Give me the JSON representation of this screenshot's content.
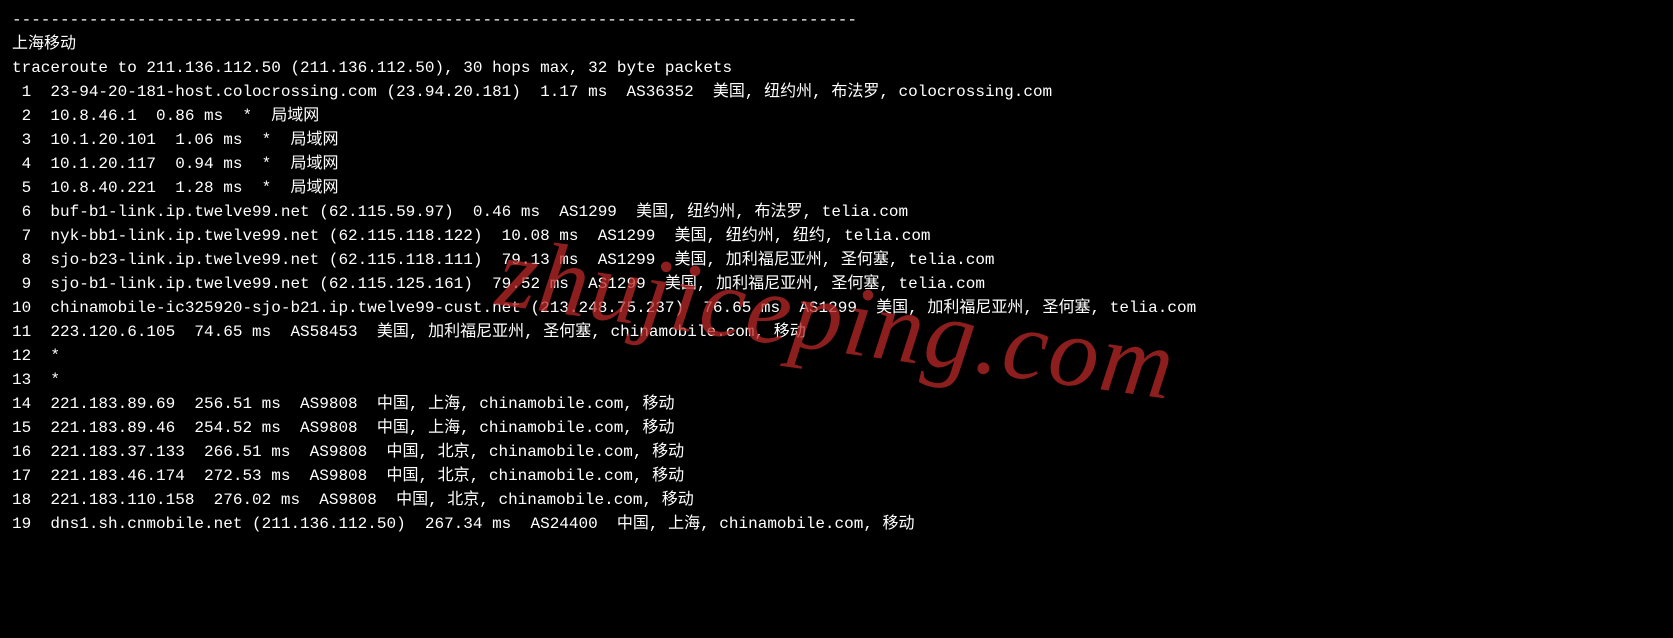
{
  "divider": "----------------------------------------------------------------------------------------",
  "title": "上海移动",
  "command": "traceroute to 211.136.112.50 (211.136.112.50), 30 hops max, 32 byte packets",
  "watermark": "zhujiceping.com",
  "hops": [
    {
      "num": " 1",
      "text": "23-94-20-181-host.colocrossing.com (23.94.20.181)  1.17 ms  AS36352  美国, 纽约州, 布法罗, colocrossing.com"
    },
    {
      "num": " 2",
      "text": "10.8.46.1  0.86 ms  *  局域网"
    },
    {
      "num": " 3",
      "text": "10.1.20.101  1.06 ms  *  局域网"
    },
    {
      "num": " 4",
      "text": "10.1.20.117  0.94 ms  *  局域网"
    },
    {
      "num": " 5",
      "text": "10.8.40.221  1.28 ms  *  局域网"
    },
    {
      "num": " 6",
      "text": "buf-b1-link.ip.twelve99.net (62.115.59.97)  0.46 ms  AS1299  美国, 纽约州, 布法罗, telia.com"
    },
    {
      "num": " 7",
      "text": "nyk-bb1-link.ip.twelve99.net (62.115.118.122)  10.08 ms  AS1299  美国, 纽约州, 纽约, telia.com"
    },
    {
      "num": " 8",
      "text": "sjo-b23-link.ip.twelve99.net (62.115.118.111)  79.13 ms  AS1299  美国, 加利福尼亚州, 圣何塞, telia.com"
    },
    {
      "num": " 9",
      "text": "sjo-b1-link.ip.twelve99.net (62.115.125.161)  79.52 ms  AS1299  美国, 加利福尼亚州, 圣何塞, telia.com"
    },
    {
      "num": "10",
      "text": "chinamobile-ic325920-sjo-b21.ip.twelve99-cust.net (213.248.75.237)  76.65 ms  AS1299  美国, 加利福尼亚州, 圣何塞, telia.com"
    },
    {
      "num": "11",
      "text": "223.120.6.105  74.65 ms  AS58453  美国, 加利福尼亚州, 圣何塞, chinamobile.com, 移动"
    },
    {
      "num": "12",
      "text": "*"
    },
    {
      "num": "13",
      "text": "*"
    },
    {
      "num": "14",
      "text": "221.183.89.69  256.51 ms  AS9808  中国, 上海, chinamobile.com, 移动"
    },
    {
      "num": "15",
      "text": "221.183.89.46  254.52 ms  AS9808  中国, 上海, chinamobile.com, 移动"
    },
    {
      "num": "16",
      "text": "221.183.37.133  266.51 ms  AS9808  中国, 北京, chinamobile.com, 移动"
    },
    {
      "num": "17",
      "text": "221.183.46.174  272.53 ms  AS9808  中国, 北京, chinamobile.com, 移动"
    },
    {
      "num": "18",
      "text": "221.183.110.158  276.02 ms  AS9808  中国, 北京, chinamobile.com, 移动"
    },
    {
      "num": "19",
      "text": "dns1.sh.cnmobile.net (211.136.112.50)  267.34 ms  AS24400  中国, 上海, chinamobile.com, 移动"
    }
  ]
}
